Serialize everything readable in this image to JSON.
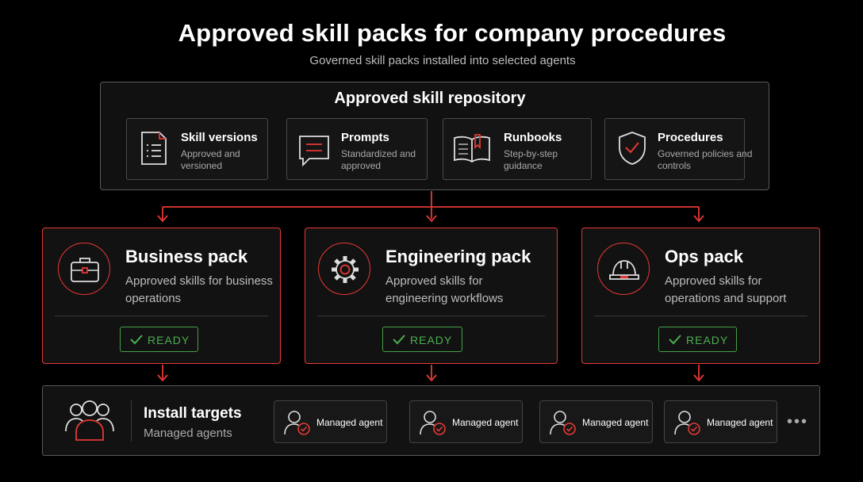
{
  "title": "Approved skill packs for company procedures",
  "subtitle": "Governed skill packs installed into selected agents",
  "repository": {
    "title": "Approved skill repository",
    "items": [
      {
        "title": "Skill versions",
        "desc": "Approved and versioned",
        "icon": "document-list-icon"
      },
      {
        "title": "Prompts",
        "desc": "Standardized and approved",
        "icon": "chat-bubble-icon"
      },
      {
        "title": "Runbooks",
        "desc": "Step-by-step guidance",
        "icon": "open-book-icon"
      },
      {
        "title": "Procedures",
        "desc": "Governed policies and controls",
        "icon": "shield-check-icon"
      }
    ]
  },
  "packs": [
    {
      "title": "Business pack",
      "desc": "Approved skills for business operations",
      "status": "READY",
      "icon": "briefcase-icon"
    },
    {
      "title": "Engineering pack",
      "desc": "Approved skills for engineering workflows",
      "status": "READY",
      "icon": "gear-icon"
    },
    {
      "title": "Ops pack",
      "desc": "Approved skills for operations and support",
      "status": "READY",
      "icon": "hard-hat-icon"
    }
  ],
  "targets": {
    "title": "Install targets",
    "subtitle": "Managed agents",
    "agents": [
      "Managed agent",
      "Managed agent",
      "Managed agent",
      "Managed agent"
    ],
    "more": "•••"
  },
  "colors": {
    "accent": "#e53935",
    "ready": "#4caf50",
    "background": "#000000"
  }
}
